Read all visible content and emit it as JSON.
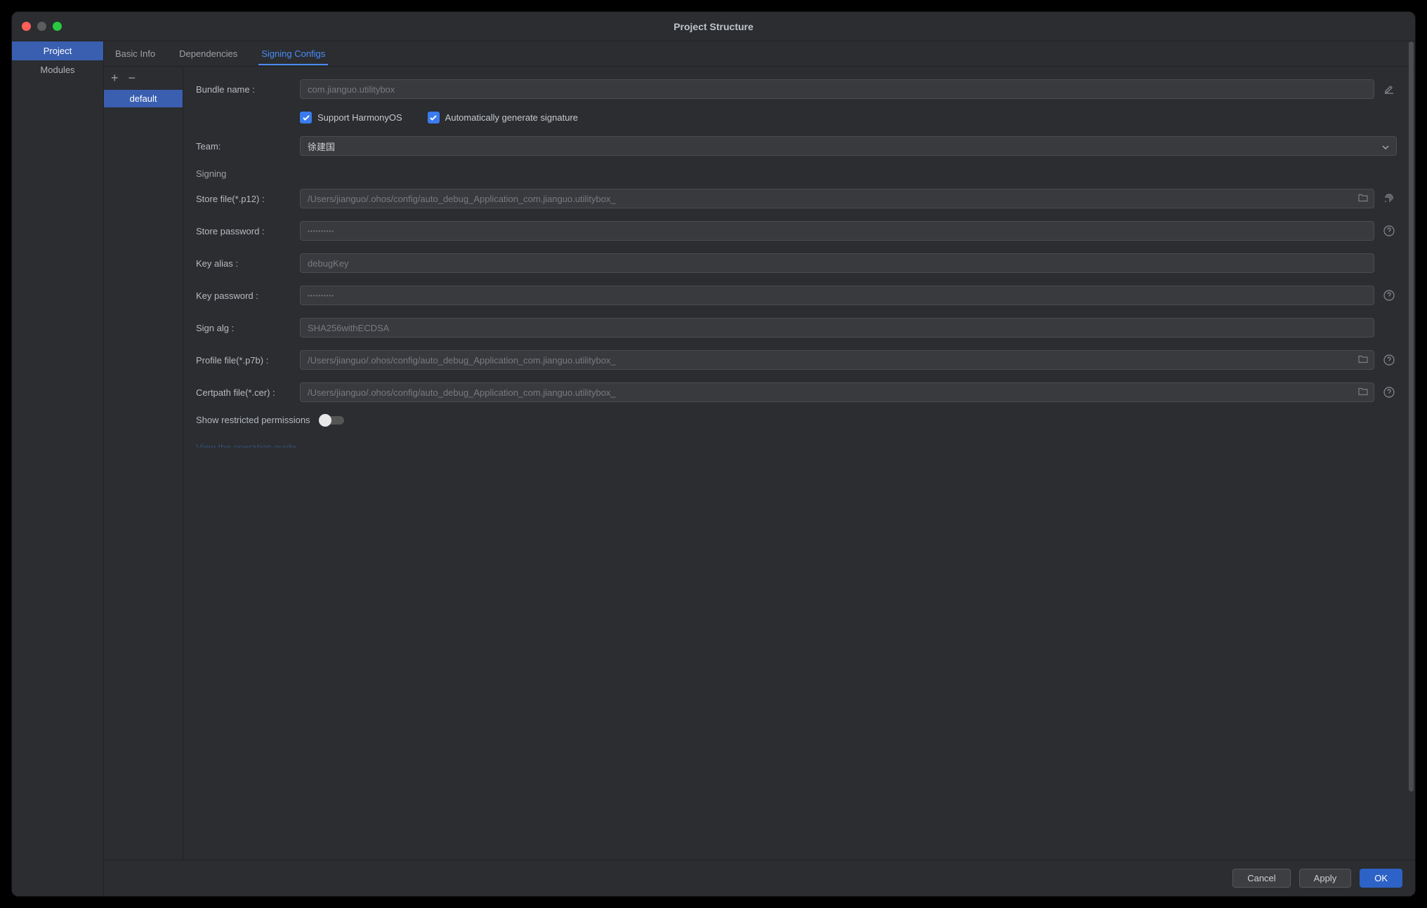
{
  "window": {
    "title": "Project Structure"
  },
  "sidebar": {
    "items": [
      {
        "label": "Project",
        "active": true
      },
      {
        "label": "Modules",
        "active": false
      }
    ]
  },
  "tabs": [
    {
      "label": "Basic Info",
      "active": false
    },
    {
      "label": "Dependencies",
      "active": false
    },
    {
      "label": "Signing Configs",
      "active": true
    }
  ],
  "configList": {
    "items": [
      {
        "label": "default",
        "active": true
      }
    ]
  },
  "form": {
    "bundle_label": "Bundle name :",
    "bundle_value": "com.jianguo.utilitybox",
    "support_label": "Support HarmonyOS",
    "auto_label": "Automatically generate signature",
    "team_label": "Team:",
    "team_value": "徐建国",
    "signing_section": "Signing",
    "store_file_label": "Store file(*.p12) :",
    "store_file_value": "/Users/jianguo/.ohos/config/auto_debug_Application_com.jianguo.utilitybox_",
    "store_pwd_label": "Store password :",
    "store_pwd_value": "••••••••••",
    "key_alias_label": "Key alias :",
    "key_alias_value": "debugKey",
    "key_pwd_label": "Key password :",
    "key_pwd_value": "••••••••••",
    "sign_alg_label": "Sign alg :",
    "sign_alg_value": "SHA256withECDSA",
    "profile_label": "Profile file(*.p7b) :",
    "profile_value": "/Users/jianguo/.ohos/config/auto_debug_Application_com.jianguo.utilitybox_",
    "certpath_label": "Certpath file(*.cer) :",
    "certpath_value": "/Users/jianguo/.ohos/config/auto_debug_Application_com.jianguo.utilitybox_",
    "restricted_label": "Show restricted permissions",
    "guide_link": "View the operation guide"
  },
  "footer": {
    "cancel": "Cancel",
    "apply": "Apply",
    "ok": "OK"
  }
}
